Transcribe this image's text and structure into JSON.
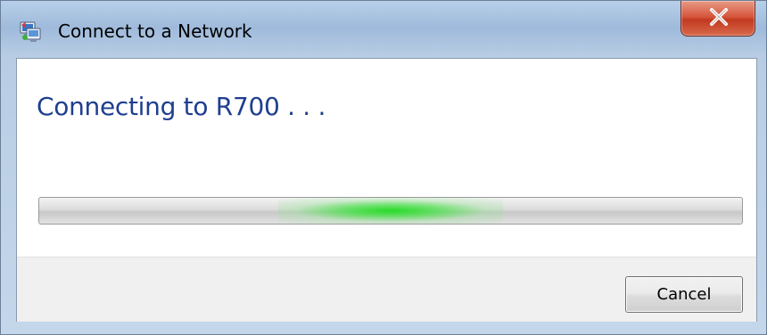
{
  "window": {
    "title": "Connect to a Network",
    "icon": "network-connection-icon"
  },
  "titlebar": {
    "close_icon": "close-icon"
  },
  "main": {
    "heading": "Connecting to R700 . . ."
  },
  "progress": {
    "mode": "indeterminate",
    "glow_center": 0.5,
    "color": "#28dc28"
  },
  "footer": {
    "cancel_label": "Cancel"
  },
  "colors": {
    "heading_text": "#1e3f8f",
    "close_button": "#c23a1f",
    "window_frame": "#b7cfe9"
  }
}
